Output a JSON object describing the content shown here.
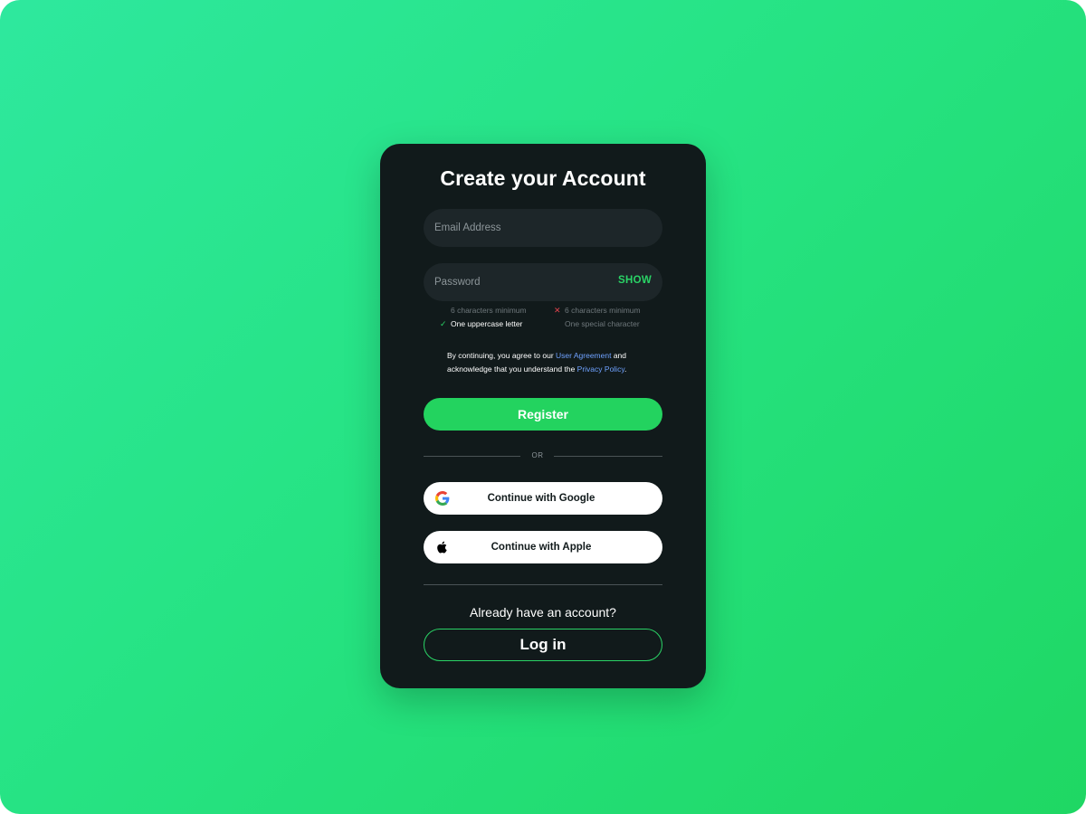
{
  "form": {
    "title": "Create your Account",
    "email": {
      "placeholder": "Email Address",
      "value": ""
    },
    "password": {
      "placeholder": "Password",
      "value": "",
      "toggle_label": "SHOW"
    },
    "rules": [
      {
        "text": "6 characters minimum",
        "state": "none"
      },
      {
        "text": "6 characters minimum",
        "state": "fail"
      },
      {
        "text": "One uppercase letter",
        "state": "pass"
      },
      {
        "text": "One special character",
        "state": "none"
      }
    ],
    "terms": {
      "prefix": "By continuing, you agree to our ",
      "link1": "User Agreement",
      "middle": " and acknowledge that you understand the ",
      "link2": "Privacy Policy",
      "suffix": "."
    },
    "register_label": "Register",
    "or_label": "OR",
    "google_label": "Continue with Google",
    "apple_label": "Continue with Apple",
    "already_label": "Already have an account?",
    "login_label": "Log in"
  },
  "icons": {
    "google": "google-icon",
    "apple": "apple-icon",
    "check": "check-icon",
    "cross": "cross-icon"
  },
  "colors": {
    "accent": "#23d35f",
    "card": "#111a1b",
    "field": "#1d2629",
    "link": "#6fa2ff",
    "error": "#e0434d"
  }
}
